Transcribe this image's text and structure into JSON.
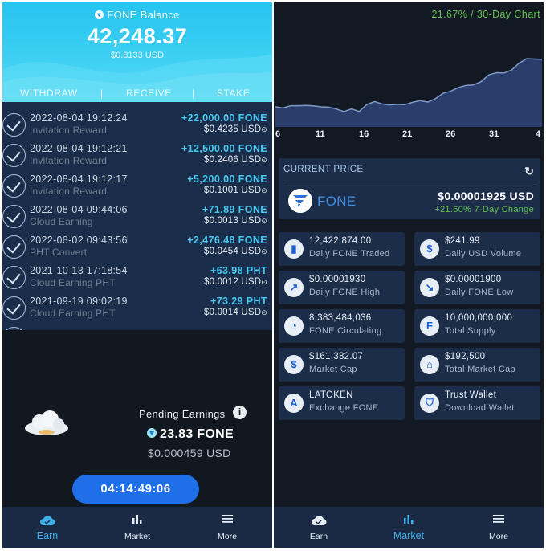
{
  "left": {
    "balance": {
      "title": "FONE Balance",
      "amount": "42,248.37",
      "usd": "$0.8133 USD"
    },
    "actions": [
      "WITHDRAW",
      "RECEIVE",
      "STAKE"
    ],
    "transactions": [
      {
        "date": "2022-08-04 19:12:24",
        "label": "Invitation Reward",
        "amount": "+22,000.00 FONE",
        "usd": "$0.4235 USD"
      },
      {
        "date": "2022-08-04 19:12:21",
        "label": "Invitation Reward",
        "amount": "+12,500.00 FONE",
        "usd": "$0.2406 USD"
      },
      {
        "date": "2022-08-04 19:12:17",
        "label": "Invitation Reward",
        "amount": "+5,200.00 FONE",
        "usd": "$0.1001 USD"
      },
      {
        "date": "2022-08-04 09:44:06",
        "label": "Cloud Earning",
        "amount": "+71.89 FONE",
        "usd": "$0.0013 USD"
      },
      {
        "date": "2022-08-02 09:43:56",
        "label": "PHT Convert",
        "amount": "+2,476.48 FONE",
        "usd": "$0.0454 USD"
      },
      {
        "date": "2021-10-13 17:18:54",
        "label": "Cloud Earning PHT",
        "amount": "+63.98 PHT",
        "usd": "$0.0012 USD"
      },
      {
        "date": "2021-09-19 09:02:19",
        "label": "Cloud Earning PHT",
        "amount": "+73.29 PHT",
        "usd": "$0.0014 USD"
      }
    ],
    "pending": {
      "title": "Pending Earnings",
      "amount": "23.83 FONE",
      "usd": "$0.000459 USD",
      "timer": "04:14:49:06"
    },
    "nav": [
      {
        "label": "Earn",
        "icon": "cloud-icon",
        "active": true
      },
      {
        "label": "Market",
        "icon": "bar-chart-icon",
        "active": false
      },
      {
        "label": "More",
        "icon": "menu-icon",
        "active": false
      }
    ]
  },
  "right": {
    "chart_header": "21.67% / 30-Day Chart",
    "chart_data": {
      "type": "area",
      "x_ticks": [
        "6",
        "11",
        "16",
        "21",
        "26",
        "31",
        "4"
      ],
      "values": [
        1.582e-05,
        1.574e-05,
        1.59e-05,
        1.59e-05,
        1.592e-05,
        1.589e-05,
        1.582e-05,
        1.58e-05,
        1.567e-05,
        1.548e-05,
        1.568e-05,
        1.549e-05,
        1.598e-05,
        1.62e-05,
        1.603e-05,
        1.596e-05,
        1.6e-05,
        1.598e-05,
        1.614e-05,
        1.626e-05,
        1.616e-05,
        1.64e-05,
        1.678e-05,
        1.693e-05,
        1.719e-05,
        1.734e-05,
        1.738e-05,
        1.761e-05,
        1.809e-05,
        1.825e-05,
        1.823e-05,
        1.844e-05,
        1.893e-05,
        1.925e-05,
        1.922e-05,
        1.92e-05
      ],
      "color": "#6f88b8"
    },
    "current_price": {
      "caption": "CURRENT PRICE",
      "token": "FONE",
      "price": "$0.00001925 USD",
      "change": "+21.60% 7-Day Change"
    },
    "stats": [
      {
        "value": "12,422,874.00",
        "label": "Daily FONE Traded",
        "icon": "bar-chart-icon",
        "glyph": "▮"
      },
      {
        "value": "$241.99",
        "label": "Daily USD Volume",
        "icon": "dollar-icon",
        "glyph": "$"
      },
      {
        "value": "$0.00001930",
        "label": "Daily FONE High",
        "icon": "trend-up-icon",
        "glyph": "↗"
      },
      {
        "value": "$0.00001900",
        "label": "Daily FONE Low",
        "icon": "trend-down-icon",
        "glyph": "↘"
      },
      {
        "value": "8,383,484,036",
        "label": "FONE Circulating",
        "icon": "pie-chart-icon",
        "glyph": "◔"
      },
      {
        "value": "10,000,000,000",
        "label": "Total Supply",
        "icon": "fone-coin-icon",
        "glyph": "F"
      },
      {
        "value": "$161,382.07",
        "label": "Market Cap",
        "icon": "dollar-icon",
        "glyph": "$"
      },
      {
        "value": "$192,500",
        "label": "Total Market Cap",
        "icon": "bank-icon",
        "glyph": "⌂"
      },
      {
        "value": "LATOKEN",
        "label": "Exchange FONE",
        "icon": "latoken-icon",
        "glyph": "A"
      },
      {
        "value": "Trust Wallet",
        "label": "Download Wallet",
        "icon": "shield-icon",
        "glyph": "⛉"
      }
    ],
    "nav": [
      {
        "label": "Earn",
        "icon": "cloud-icon",
        "active": false
      },
      {
        "label": "Market",
        "icon": "bar-chart-icon",
        "active": true
      },
      {
        "label": "More",
        "icon": "menu-icon",
        "active": false
      }
    ]
  }
}
